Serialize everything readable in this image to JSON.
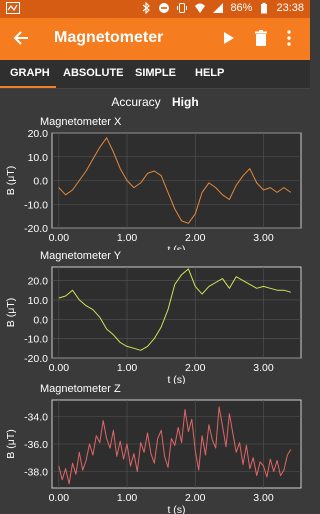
{
  "status_bar": {
    "battery": "86%",
    "time": "23:38"
  },
  "app_bar": {
    "title": "Magnetometer"
  },
  "tabs": [
    {
      "label": "GRAPH",
      "active": true
    },
    {
      "label": "ABSOLUTE",
      "active": false
    },
    {
      "label": "SIMPLE",
      "active": false
    },
    {
      "label": "HELP",
      "active": false
    }
  ],
  "accuracy": {
    "label": "Accuracy",
    "value": "High"
  },
  "colors": {
    "accent": "#f57c1f",
    "x_series": "#e3893a",
    "y_series": "#d4e157",
    "z_series": "#e06666"
  },
  "chart_data": [
    {
      "type": "line",
      "title": "Magnetometer X",
      "xlabel": "t (s)",
      "ylabel": "B (μT)",
      "xlim": [
        -0.1,
        3.55
      ],
      "ylim": [
        -20.0,
        20.0
      ],
      "xticks": [
        "0.00",
        "1.00",
        "2.00",
        "3.00"
      ],
      "xtick_values": [
        0,
        1,
        2,
        3
      ],
      "yticks": [
        "20.0",
        "10.0",
        "0.0",
        "-10.0",
        "-20.0"
      ],
      "ytick_values": [
        20,
        10,
        0,
        -10,
        -20
      ],
      "color": "#e3893a",
      "x": [
        0.0,
        0.1,
        0.2,
        0.3,
        0.4,
        0.5,
        0.6,
        0.7,
        0.8,
        0.9,
        1.0,
        1.1,
        1.2,
        1.3,
        1.4,
        1.5,
        1.6,
        1.7,
        1.8,
        1.9,
        2.0,
        2.1,
        2.2,
        2.3,
        2.4,
        2.5,
        2.6,
        2.7,
        2.8,
        2.9,
        3.0,
        3.1,
        3.2,
        3.3,
        3.4
      ],
      "values": [
        -3,
        -6,
        -4,
        0,
        4,
        9,
        14,
        18,
        12,
        5,
        0,
        -3,
        -1,
        3,
        4,
        2,
        -5,
        -12,
        -17,
        -18,
        -14,
        -5,
        -1,
        -3,
        -6,
        -8,
        -2,
        2,
        5,
        -1,
        -4,
        -3,
        -5,
        -3,
        -5
      ]
    },
    {
      "type": "line",
      "title": "Magnetometer Y",
      "xlabel": "t (s)",
      "ylabel": "B (μT)",
      "xlim": [
        -0.1,
        3.55
      ],
      "ylim": [
        -20.0,
        27.0
      ],
      "xticks": [
        "0.00",
        "1.00",
        "2.00",
        "3.00"
      ],
      "xtick_values": [
        0,
        1,
        2,
        3
      ],
      "yticks": [
        "20.0",
        "10.0",
        "0.0",
        "-10.0",
        "-20.0"
      ],
      "ytick_values": [
        20,
        10,
        0,
        -10,
        -20
      ],
      "color": "#d4e157",
      "x": [
        0.0,
        0.1,
        0.2,
        0.3,
        0.4,
        0.5,
        0.6,
        0.7,
        0.8,
        0.9,
        1.0,
        1.1,
        1.2,
        1.3,
        1.4,
        1.5,
        1.6,
        1.7,
        1.8,
        1.9,
        2.0,
        2.1,
        2.2,
        2.3,
        2.4,
        2.5,
        2.6,
        2.7,
        2.8,
        2.9,
        3.0,
        3.1,
        3.2,
        3.3,
        3.4
      ],
      "values": [
        11,
        12,
        15,
        10,
        7,
        5,
        1,
        -5,
        -8,
        -12,
        -14,
        -15,
        -16,
        -14,
        -10,
        -4,
        5,
        18,
        23,
        26,
        17,
        13,
        17,
        19,
        21,
        16,
        22,
        20,
        18,
        16,
        17,
        16,
        15,
        15,
        14
      ]
    },
    {
      "type": "line",
      "title": "Magnetometer Z",
      "xlabel": "t (s)",
      "ylabel": "B (μT)",
      "xlim": [
        -0.1,
        3.55
      ],
      "ylim": [
        -39.2,
        -32.8
      ],
      "xticks": [
        "0.00",
        "1.00",
        "2.00",
        "3.00"
      ],
      "xtick_values": [
        0,
        1,
        2,
        3
      ],
      "yticks": [
        "-34.0",
        "-36.0",
        "-38.0"
      ],
      "ytick_values": [
        -34,
        -36,
        -38
      ],
      "color": "#e06666",
      "x": [
        0.0,
        0.05,
        0.1,
        0.15,
        0.2,
        0.25,
        0.3,
        0.35,
        0.4,
        0.45,
        0.5,
        0.55,
        0.6,
        0.65,
        0.7,
        0.75,
        0.8,
        0.85,
        0.9,
        0.95,
        1.0,
        1.05,
        1.1,
        1.15,
        1.2,
        1.25,
        1.3,
        1.35,
        1.4,
        1.45,
        1.5,
        1.55,
        1.6,
        1.65,
        1.7,
        1.75,
        1.8,
        1.85,
        1.9,
        1.95,
        2.0,
        2.05,
        2.1,
        2.15,
        2.2,
        2.25,
        2.3,
        2.35,
        2.4,
        2.45,
        2.5,
        2.55,
        2.6,
        2.65,
        2.7,
        2.75,
        2.8,
        2.85,
        2.9,
        2.95,
        3.0,
        3.05,
        3.1,
        3.15,
        3.2,
        3.25,
        3.3,
        3.35,
        3.4
      ],
      "values": [
        -37.6,
        -38.6,
        -37.8,
        -38.9,
        -37.4,
        -38.2,
        -36.6,
        -37.9,
        -37.2,
        -36.0,
        -36.8,
        -35.4,
        -35.9,
        -34.3,
        -35.6,
        -36.3,
        -35.0,
        -36.9,
        -35.8,
        -37.1,
        -36.0,
        -37.6,
        -36.7,
        -38.0,
        -35.9,
        -36.6,
        -35.2,
        -36.7,
        -37.4,
        -35.6,
        -35.0,
        -36.9,
        -37.7,
        -35.6,
        -36.1,
        -34.8,
        -35.9,
        -33.5,
        -35.1,
        -34.2,
        -36.5,
        -37.9,
        -35.4,
        -36.8,
        -34.6,
        -35.7,
        -36.3,
        -33.3,
        -34.7,
        -36.2,
        -33.8,
        -35.2,
        -36.6,
        -35.9,
        -37.5,
        -36.1,
        -37.8,
        -37.0,
        -38.3,
        -37.3,
        -37.6,
        -38.4,
        -37.1,
        -38.0,
        -37.2,
        -38.3,
        -37.9,
        -36.8,
        -36.4
      ]
    }
  ]
}
